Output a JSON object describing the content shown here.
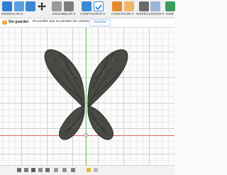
{
  "toolbar": {
    "modificar_label": "MODIFICAR ▾",
    "ensamblar_label": "ENSAMBLAR ▾",
    "configurar_label": "CONFIGURAR ▾",
    "construir_label": "CONSTRUIR ▾",
    "inspeccionar_label": "INSPECCIONAR ▾",
    "insertar_label": "INSE",
    "colors": {
      "modify_blue": "#2f7fd0",
      "assemble": "#8a8a8a",
      "configure": "#3a8ad6",
      "construct_orange": "#e48b2c",
      "inspect": "#6a6a6a"
    },
    "icons": [
      "push-pull-icon",
      "press-pull-icon",
      "fillet-icon",
      "move-icon",
      "joint-icon",
      "rigid-group-icon",
      "parameters-icon",
      "check-icon",
      "plane-icon",
      "measure-icon",
      "interference-icon",
      "insert-icon"
    ]
  },
  "warning": {
    "title": "Sin guardar:",
    "message": "Es posible que se pierdan los cambios",
    "button": "Guardar"
  },
  "canvas": {
    "model": "butterfly-wings",
    "grid": true,
    "model_color": "#4a4a45"
  }
}
